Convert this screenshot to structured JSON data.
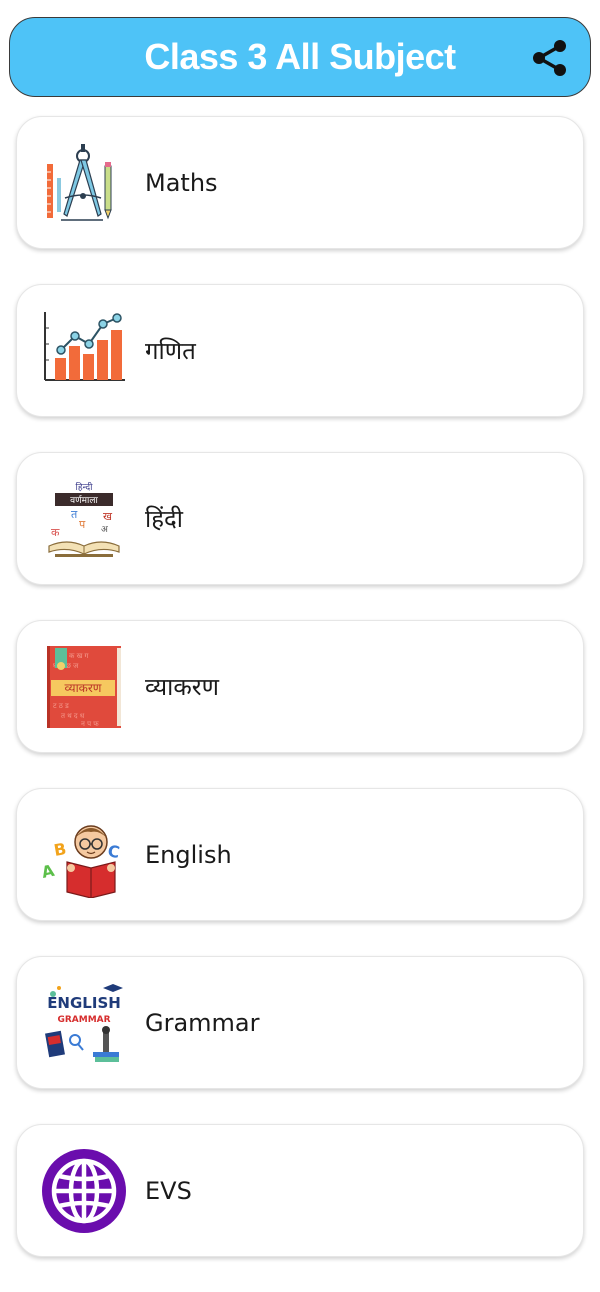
{
  "header": {
    "title": "Class 3 All Subject",
    "share_icon": "share-icon"
  },
  "subjects": [
    {
      "label": "Maths",
      "icon": "drafting-compass-icon"
    },
    {
      "label": "गणित",
      "icon": "bar-line-chart-icon"
    },
    {
      "label": "हिंदी",
      "icon": "hindi-varnamala-book-icon",
      "icon_text": [
        "हिन्दी",
        "वर्णमाला",
        "क",
        "प",
        "त",
        "ख",
        "अ"
      ]
    },
    {
      "label": "व्याकरण",
      "icon": "vyakaran-book-icon",
      "icon_text": [
        "व्याकरण"
      ]
    },
    {
      "label": "English",
      "icon": "abc-reading-kid-icon",
      "icon_text": [
        "A",
        "B",
        "C"
      ]
    },
    {
      "label": "Grammar",
      "icon": "english-grammar-illustration-icon",
      "icon_text": [
        "ENGLISH",
        "GRAMMAR"
      ]
    },
    {
      "label": "EVS",
      "icon": "globe-icon"
    }
  ],
  "colors": {
    "header_bg": "#4ec3f7",
    "header_text": "#ffffff",
    "globe_purple": "#6a0dad",
    "chart_orange": "#f26b3a",
    "vyakaran_red": "#e04a3c"
  }
}
